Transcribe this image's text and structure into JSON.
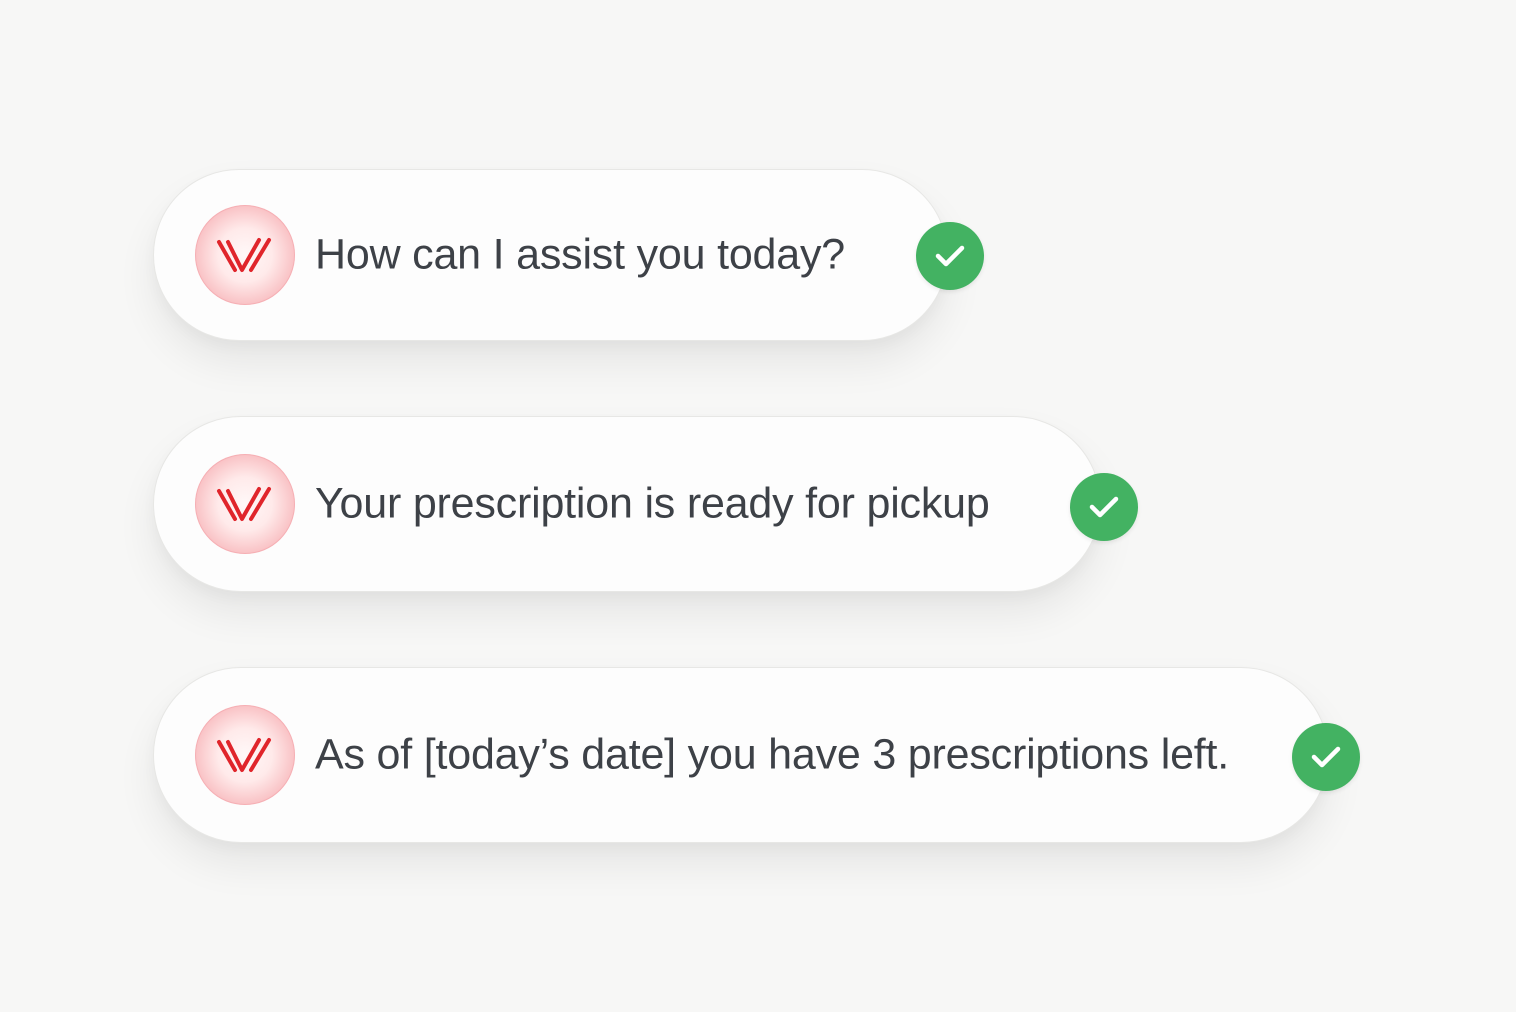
{
  "messages": [
    {
      "text": "How can I assist you today?",
      "status_icon": "checkmark-circle-icon",
      "avatar_icon": "brand-logo-icon"
    },
    {
      "text": "Your prescription is ready for pickup",
      "status_icon": "checkmark-circle-icon",
      "avatar_icon": "brand-logo-icon"
    },
    {
      "text": "As of [today’s date] you have 3 prescriptions left.",
      "status_icon": "checkmark-circle-icon",
      "avatar_icon": "brand-logo-icon"
    }
  ],
  "colors": {
    "background": "#f7f7f6",
    "bubble": "#fdfdfd",
    "text": "#3d4147",
    "check": "#43b262",
    "brand": "#e0252b"
  }
}
